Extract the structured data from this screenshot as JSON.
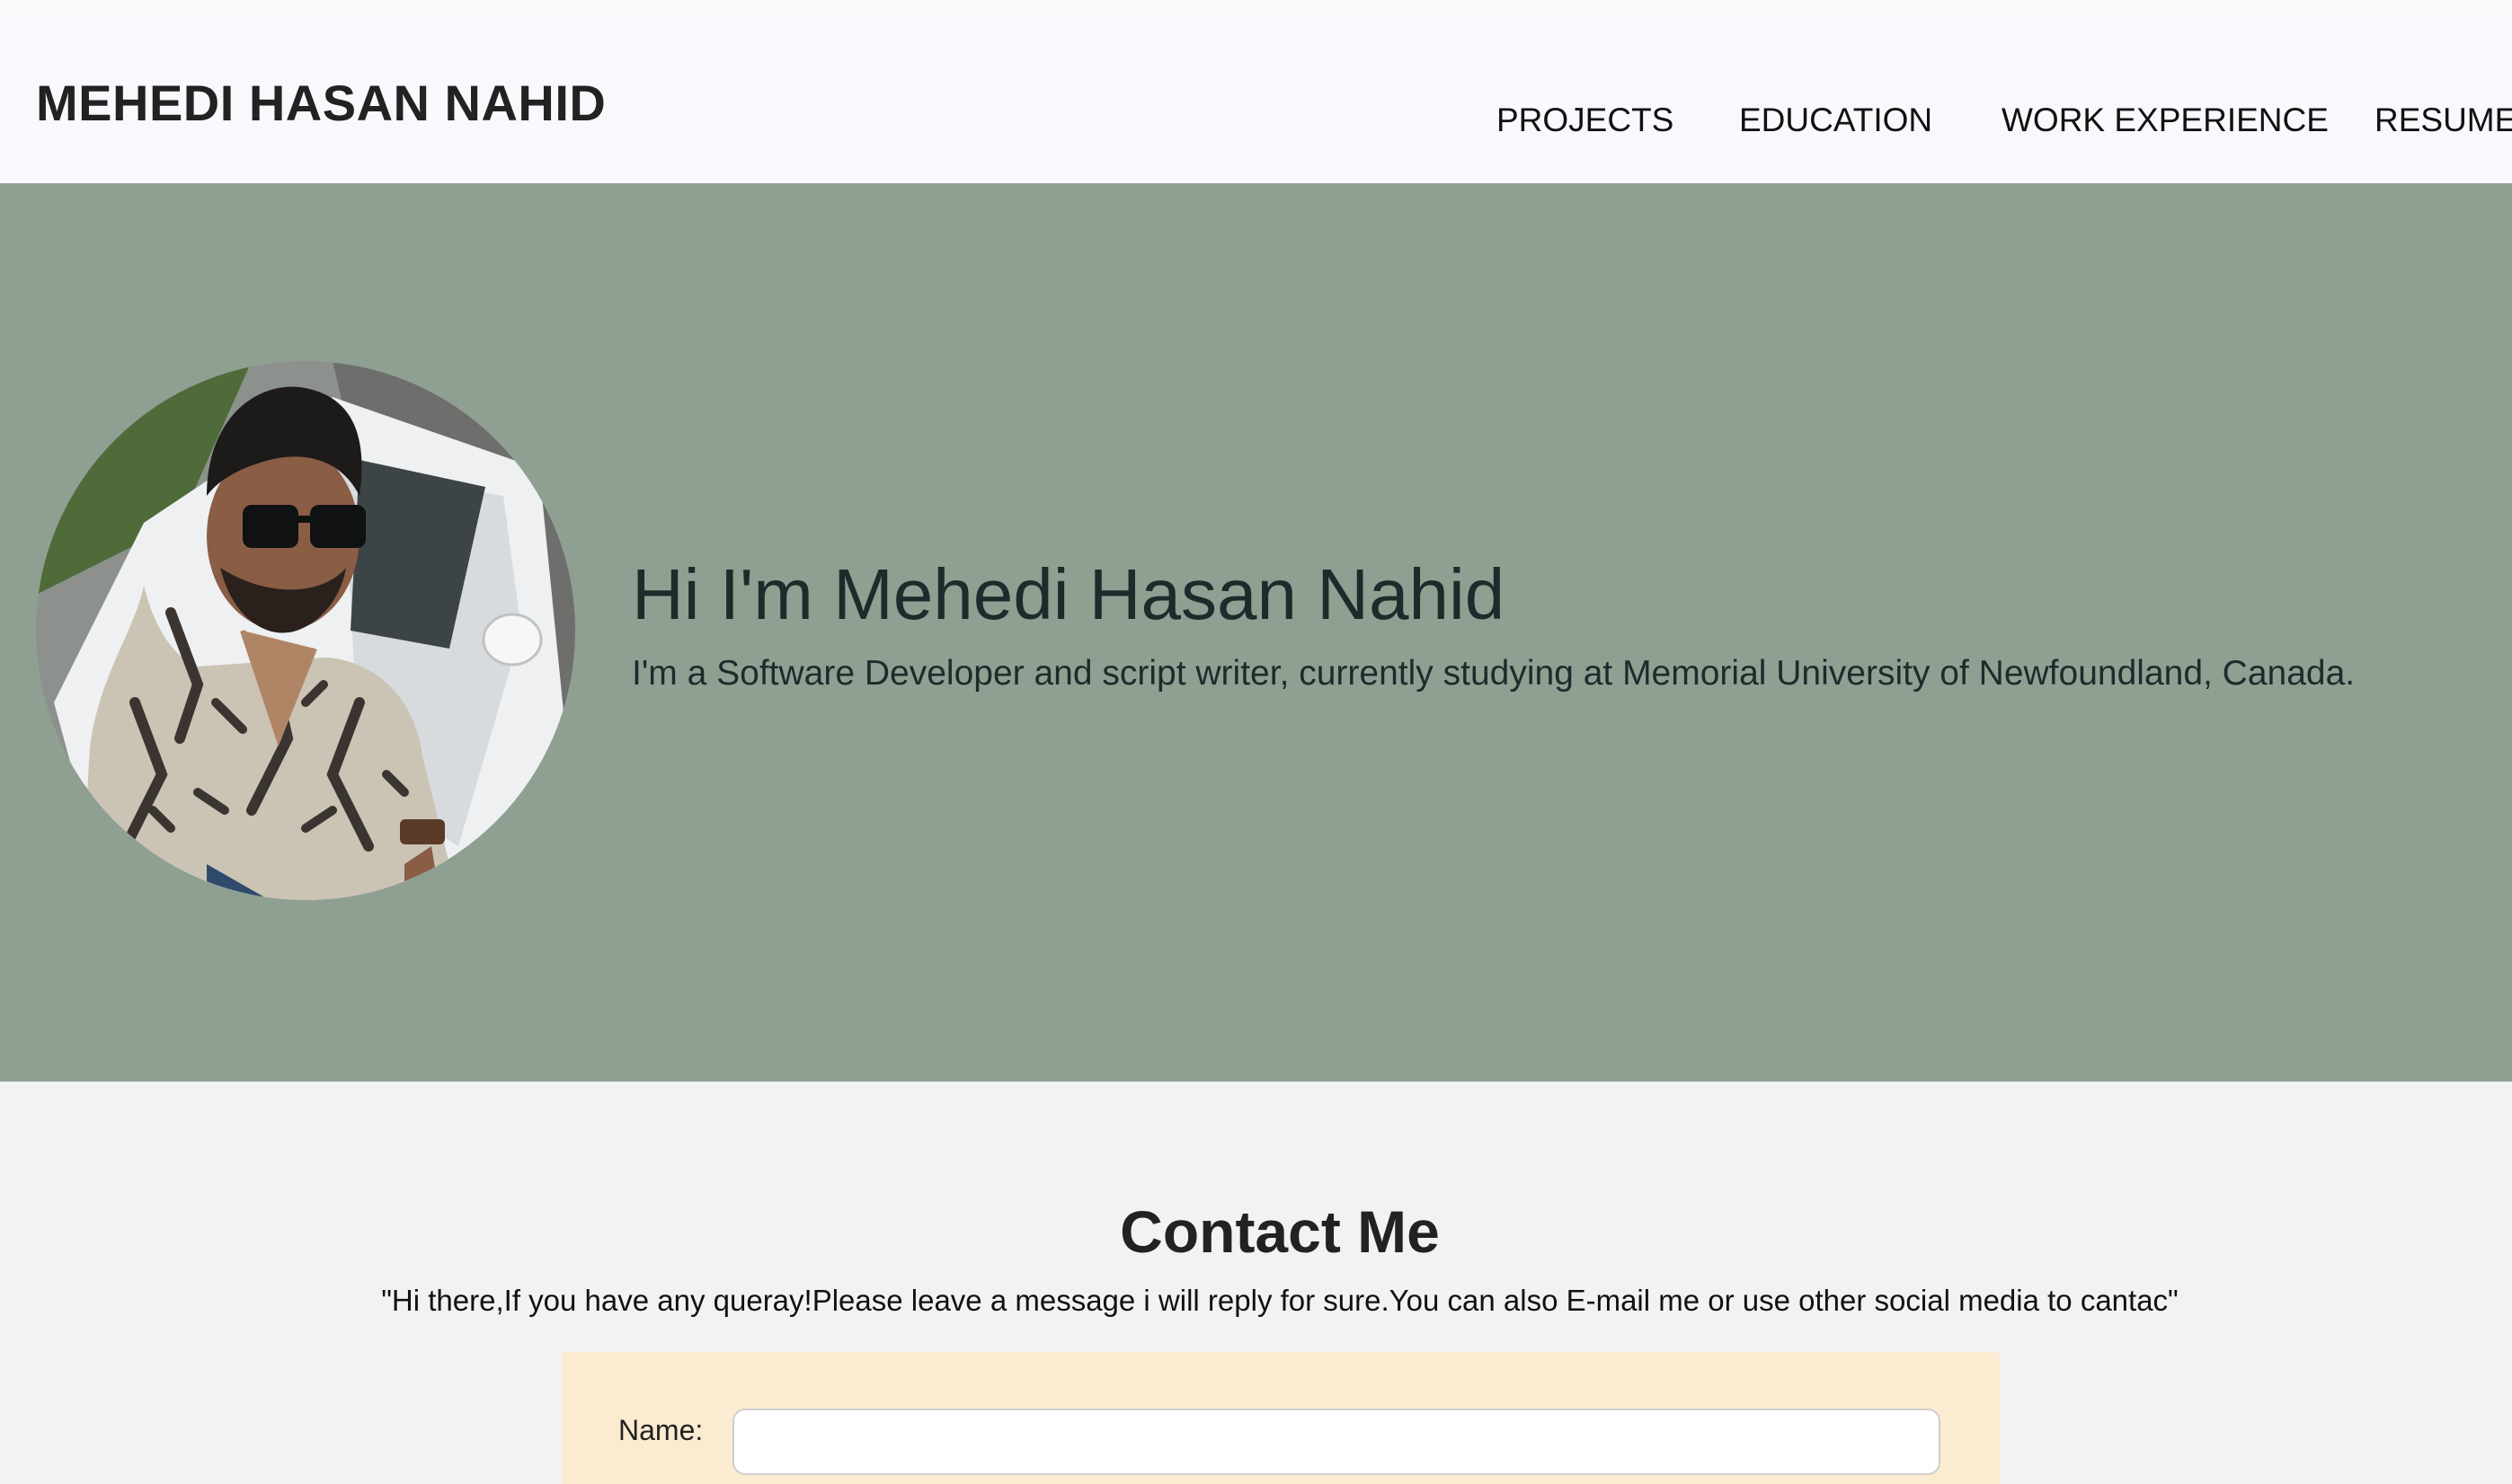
{
  "header": {
    "brand": "MEHEDI HASAN NAHID",
    "nav": [
      {
        "label": "PROJECTS"
      },
      {
        "label": "EDUCATION"
      },
      {
        "label": "WORK EXPERIENCE"
      },
      {
        "label": "RESUME"
      }
    ]
  },
  "hero": {
    "title": "Hi I'm Mehedi Hasan Nahid",
    "subtitle": "I'm a Software Developer and script writer, currently studying at Memorial University of Newfoundland, Canada.",
    "background_color": "#8fa093"
  },
  "contact": {
    "title": "Contact Me",
    "message": "\"Hi there,If you have any queray!Please leave a message i will reply for sure.You can also E-mail me or use other social media to cantac\"",
    "form": {
      "name_label": "Name:",
      "name_value": ""
    },
    "form_background_color": "#fbebd1"
  }
}
